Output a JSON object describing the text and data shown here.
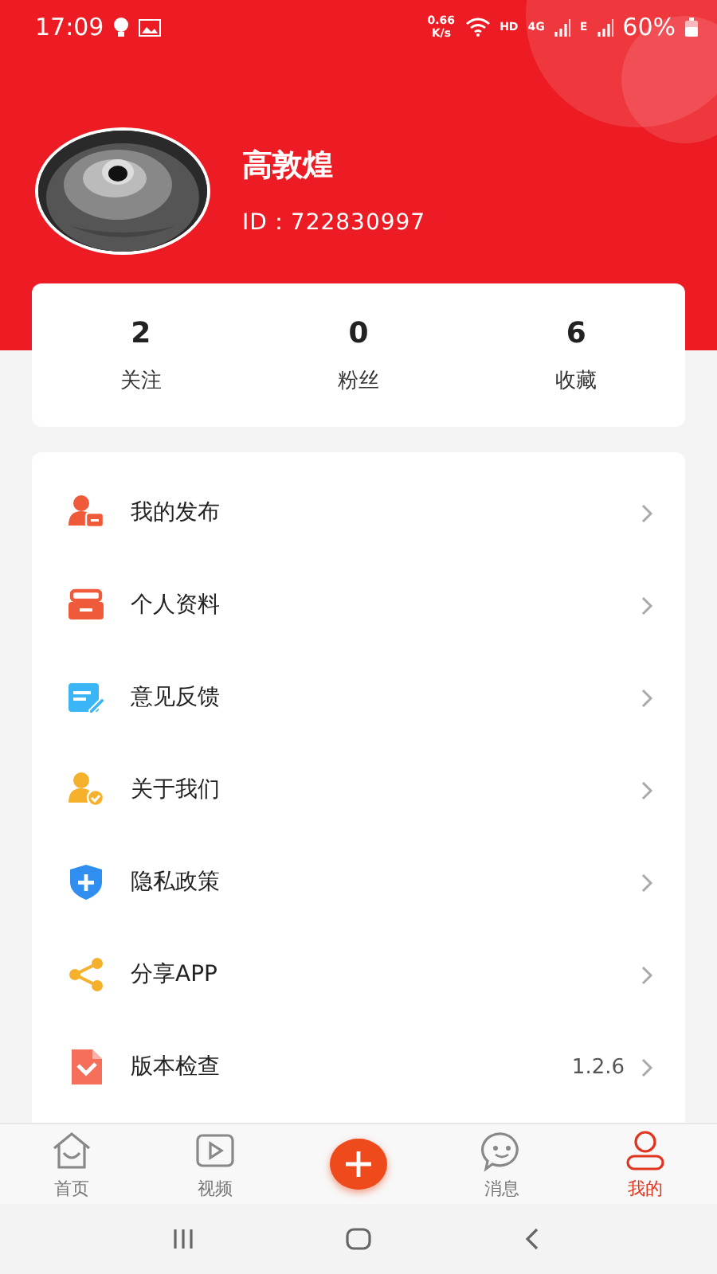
{
  "status_bar": {
    "time": "17:09",
    "speed": "0.66",
    "speed_unit": "K/s",
    "hd": "HD",
    "net": "4G",
    "net2": "E",
    "battery": "60%"
  },
  "profile": {
    "name": "高敦煌",
    "id": "ID：722830997"
  },
  "stats": [
    {
      "value": "2",
      "label": "关注"
    },
    {
      "value": "0",
      "label": "粉丝"
    },
    {
      "value": "6",
      "label": "收藏"
    }
  ],
  "menu": [
    {
      "label": "我的发布"
    },
    {
      "label": "个人资料"
    },
    {
      "label": "意见反馈"
    },
    {
      "label": "关于我们"
    },
    {
      "label": "隐私政策"
    },
    {
      "label": "分享APP"
    },
    {
      "label": "版本检查",
      "value": "1.2.6"
    }
  ],
  "tab_bar": [
    {
      "label": "首页",
      "kind": "tab",
      "selected": false
    },
    {
      "label": "视频",
      "kind": "tab",
      "selected": false
    },
    {
      "kind": "add"
    },
    {
      "label": "消息",
      "kind": "tab",
      "selected": false
    },
    {
      "label": "我的",
      "kind": "tab",
      "selected": true
    }
  ]
}
